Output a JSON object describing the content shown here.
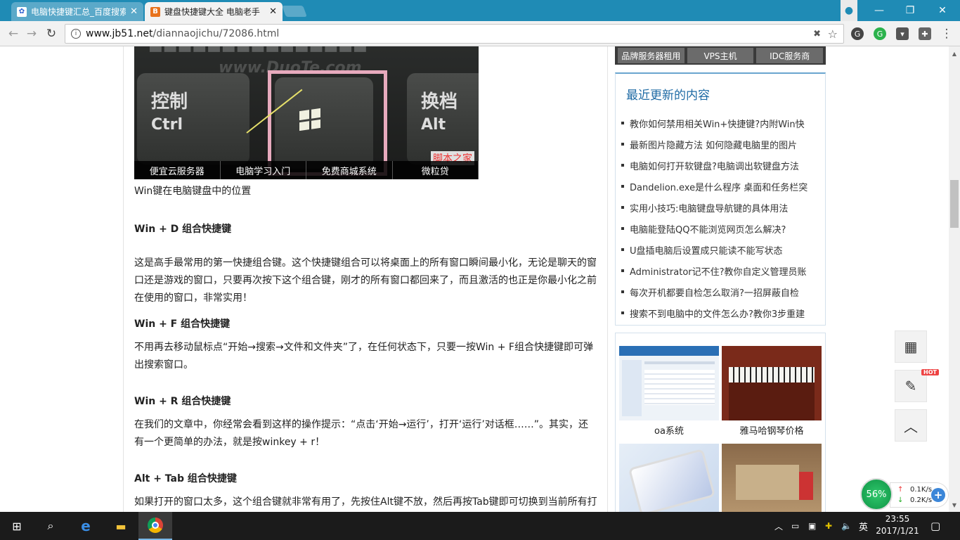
{
  "browser": {
    "tabs": [
      {
        "title": "电脑快捷键汇总_百度搜索",
        "favicon": "baidu-paw"
      },
      {
        "title": "键盘快捷键大全 电脑老手",
        "favicon": "jb51-logo"
      }
    ],
    "url_domain": "www.jb51.net",
    "url_path": "/diannaojichu/72086.html"
  },
  "article": {
    "image_keys": {
      "ctrl_zh": "控制",
      "ctrl_en": "Ctrl",
      "alt_zh": "换档",
      "alt_en": "Alt"
    },
    "image_watermark": "www.DuoTe.com",
    "image_brand": "脚本之家",
    "ad_links": [
      "便宜云服务器",
      "电脑学习入门",
      "免费商城系统",
      "微粒贷"
    ],
    "caption": "Win键在电脑键盘中的位置",
    "sections": [
      {
        "heading": "Win + D 组合快捷键",
        "body": "这是高手最常用的第一快捷组合键。这个快捷键组合可以将桌面上的所有窗口瞬间最小化，无论是聊天的窗口还是游戏的窗口，只要再次按下这个组合键，刚才的所有窗口都回来了，而且激活的也正是你最小化之前在使用的窗口，非常实用！"
      },
      {
        "heading": "Win + F 组合快捷键",
        "body": "不用再去移动鼠标点“开始→搜索→文件和文件夹”了，在任何状态下，只要一按Win + F组合快捷键即可弹出搜索窗口。"
      },
      {
        "heading": "Win + R 组合快捷键",
        "body": "在我们的文章中，你经常会看到这样的操作提示：“点击‘开始→运行’，打开‘运行’对话框……”。其实，还有一个更简单的办法，就是按winkey + r！"
      },
      {
        "heading": "Alt + Tab 组合快捷键",
        "body": "如果打开的窗口太多，这个组合键就非常有用了，先按住Alt键不放，然后再按Tab键即可切换到当前所有打"
      }
    ]
  },
  "sidebar": {
    "services": [
      "品牌服务器租用",
      "VPS主机",
      "IDC服务商"
    ],
    "recent_title": "最近更新的内容",
    "recent_items": [
      "教你如何禁用相关Win+快捷键?内附Win快",
      "最新图片隐藏方法 如何隐藏电脑里的图片",
      "电脑如何打开软键盘?电脑调出软键盘方法",
      "Dandelion.exe是什么程序 桌面和任务栏突",
      "实用小技巧:电脑键盘导航键的具体用法",
      "电脑能登陆QQ不能浏览网页怎么解决?",
      "U盘插电脑后设置成只能读不能写状态",
      "Administrator记不住?教你自定义管理员账",
      "每次开机都要自检怎么取消?一招屏蔽自检",
      "搜索不到电脑中的文件怎么办?教你3步重建"
    ],
    "pictures": [
      {
        "label": "oa系统"
      },
      {
        "label": "雅马哈钢琴价格"
      }
    ]
  },
  "float_tools": {
    "hot_badge": "HOT"
  },
  "net_monitor": {
    "percent": "56%",
    "up": "0.1K/s",
    "down": "0.2K/s"
  },
  "taskbar": {
    "ime": "英",
    "time": "23:55",
    "date": "2017/1/21"
  }
}
